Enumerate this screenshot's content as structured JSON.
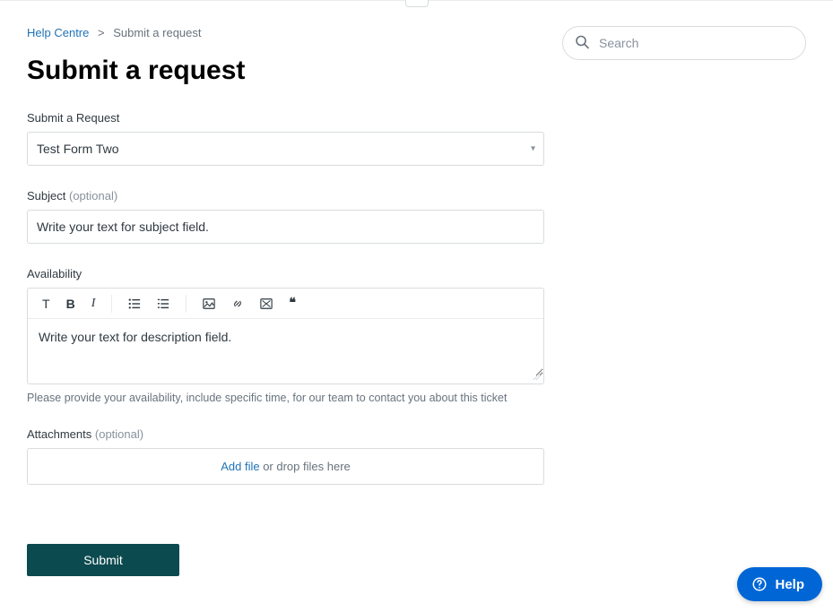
{
  "breadcrumb": {
    "home": "Help Centre",
    "separator": ">",
    "current": "Submit a request"
  },
  "title": "Submit a request",
  "search": {
    "placeholder": "Search"
  },
  "fields": {
    "request_type": {
      "label": "Submit a Request",
      "value": "Test Form Two"
    },
    "subject": {
      "label": "Subject",
      "optional": "(optional)",
      "value": "Write your text for subject field."
    },
    "availability": {
      "label": "Availability",
      "body": "Write your text for description field.",
      "help": "Please provide your availability, include specific time, for our team to contact you about this ticket"
    },
    "attachments": {
      "label": "Attachments",
      "optional": "(optional)",
      "add_file": "Add file",
      "drop_text": " or drop files here"
    }
  },
  "toolbar": {
    "text": "T",
    "bold": "B",
    "italic": "I",
    "ul": "bulleted-list",
    "ol": "numbered-list",
    "image": "image",
    "link": "link",
    "code": "embed",
    "quote": "quote"
  },
  "submit": "Submit",
  "help_widget": "Help"
}
